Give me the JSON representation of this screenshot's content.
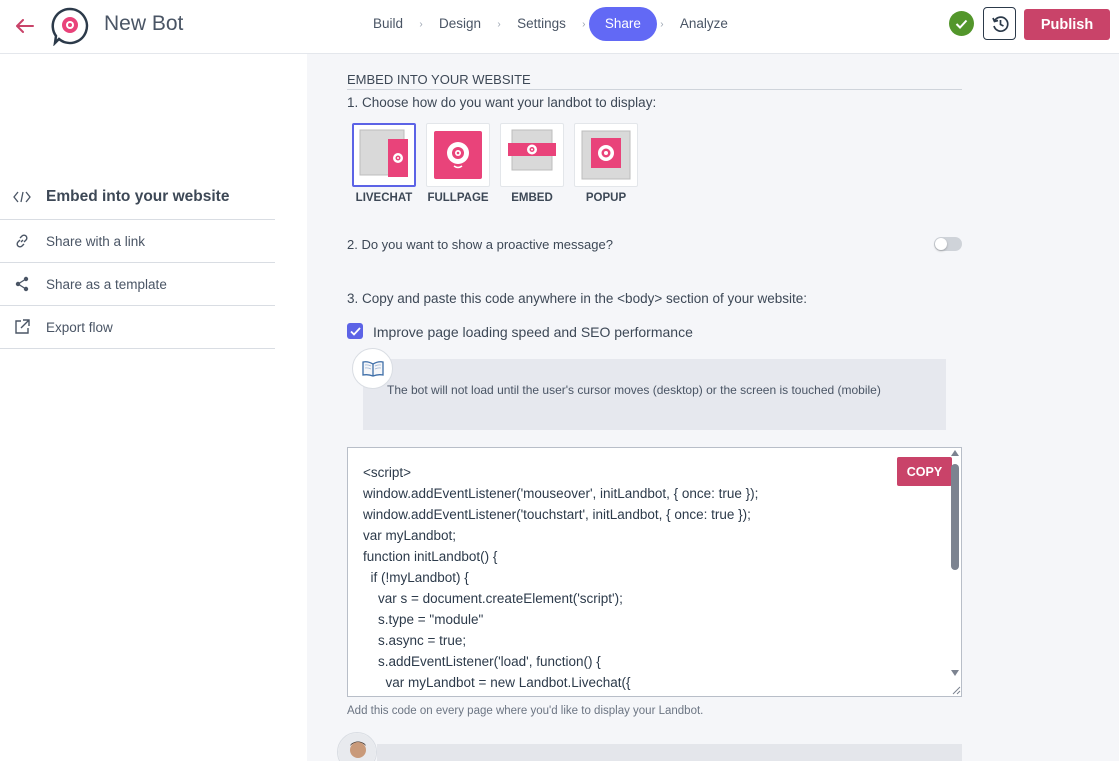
{
  "header": {
    "bot_name": "New Bot",
    "steps": [
      {
        "label": "Build"
      },
      {
        "label": "Design"
      },
      {
        "label": "Settings"
      },
      {
        "label": "Share"
      },
      {
        "label": "Analyze"
      }
    ],
    "active_step": "Share",
    "publish_label": "Publish",
    "colors": {
      "brand": "#c94369",
      "accent": "#6269f5",
      "ok": "#53962b"
    }
  },
  "sidebar": {
    "items": [
      {
        "label": "Embed into your website",
        "icon": "code-icon",
        "active": true
      },
      {
        "label": "Share with a link",
        "icon": "link-icon"
      },
      {
        "label": "Share as a template",
        "icon": "share-icon"
      },
      {
        "label": "Export flow",
        "icon": "export-icon"
      }
    ]
  },
  "main": {
    "section_title": "EMBED INTO YOUR WEBSITE",
    "q1": "1. Choose how do you want your landbot to display:",
    "display_options": [
      {
        "label": "LIVECHAT",
        "selected": true
      },
      {
        "label": "FULLPAGE"
      },
      {
        "label": "EMBED"
      },
      {
        "label": "POPUP"
      }
    ],
    "q2": "2. Do you want to show a proactive message?",
    "proactive_enabled": false,
    "q3": "3. Copy and paste this code anywhere in the <body> section of your website:",
    "seo_label": "Improve page loading speed and SEO performance",
    "seo_checked": true,
    "info_text": "The bot will not load until the user's cursor moves (desktop) or the screen is touched (mobile)",
    "code_lines": [
      "<script>",
      "window.addEventListener('mouseover', initLandbot, { once: true });",
      "window.addEventListener('touchstart', initLandbot, { once: true });",
      "var myLandbot;",
      "function initLandbot() {",
      "  if (!myLandbot) {",
      "    var s = document.createElement('script');",
      "    s.type = \"module\"",
      "    s.async = true;",
      "    s.addEventListener('load', function() {",
      "      var myLandbot = new Landbot.Livechat({"
    ],
    "copy_label": "COPY",
    "hint": "Add this code on every page where you'd like to display your Landbot."
  }
}
